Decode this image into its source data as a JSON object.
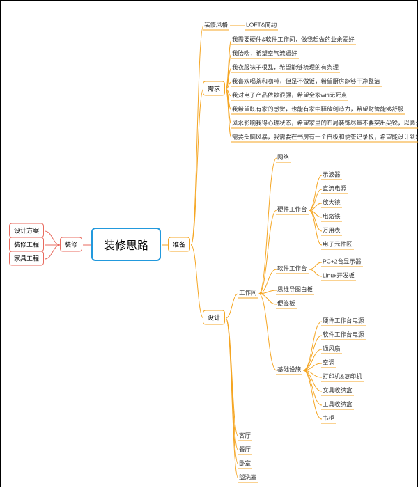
{
  "chart_data": {
    "type": "mindmap",
    "root": "装修思路",
    "left": {
      "hub": "装修",
      "items": [
        "设计方案",
        "装修工程",
        "家具工程"
      ]
    },
    "right": {
      "hub": "准备",
      "children": [
        {
          "label": "装修风格",
          "children": [
            "LOFT&简约"
          ]
        },
        {
          "label": "需求",
          "children": [
            "我需要硬件&软件工作间，做我想做的业余爱好",
            "我胎喘，希望空气流通好",
            "我衣服袜子很乱，希望能够梳理的有条理",
            "我喜欢喝茶和咖啡，但是不做饭，希望厨房能够干净整洁",
            "我对电子产品依赖很强，希望全家wifi无死点",
            "我希望既有家的感觉，也能有家中释放创造力，希望财管能够舒服",
            "风水影响我得心理状态，希望家里的布局装饰尽量不要突出尖锐，以圆滑为主",
            "需要头脑风暴，我需要在书房有一个白板和便签记录板，希望能设计到墙面和主格调融入"
          ]
        },
        {
          "label": "设计",
          "children": [
            {
              "label": "工作间",
              "children": [
                {
                  "label": "网络",
                  "children": []
                },
                {
                  "label": "硬件工作台",
                  "children": [
                    "示波器",
                    "直流电源",
                    "放大镜",
                    "电烙铁",
                    "万用表",
                    "电子元件区"
                  ]
                },
                {
                  "label": "软件工作台",
                  "children": [
                    "PC+2台显示器",
                    "Linux开发板"
                  ]
                },
                {
                  "label": "思维导图白板",
                  "children": []
                },
                {
                  "label": "便签板",
                  "children": []
                },
                {
                  "label": "基础设施",
                  "children": [
                    "硬件工作台电源",
                    "软件工作台电源",
                    "通风扇",
                    "空调",
                    "打印机&复印机",
                    "文具收纳盒",
                    "工具收纳盒",
                    "书柜"
                  ]
                }
              ]
            },
            {
              "label": "客厅",
              "children": []
            },
            {
              "label": "餐厅",
              "children": []
            },
            {
              "label": "卧室",
              "children": []
            },
            {
              "label": "盥洗室",
              "children": []
            }
          ]
        }
      ]
    }
  }
}
